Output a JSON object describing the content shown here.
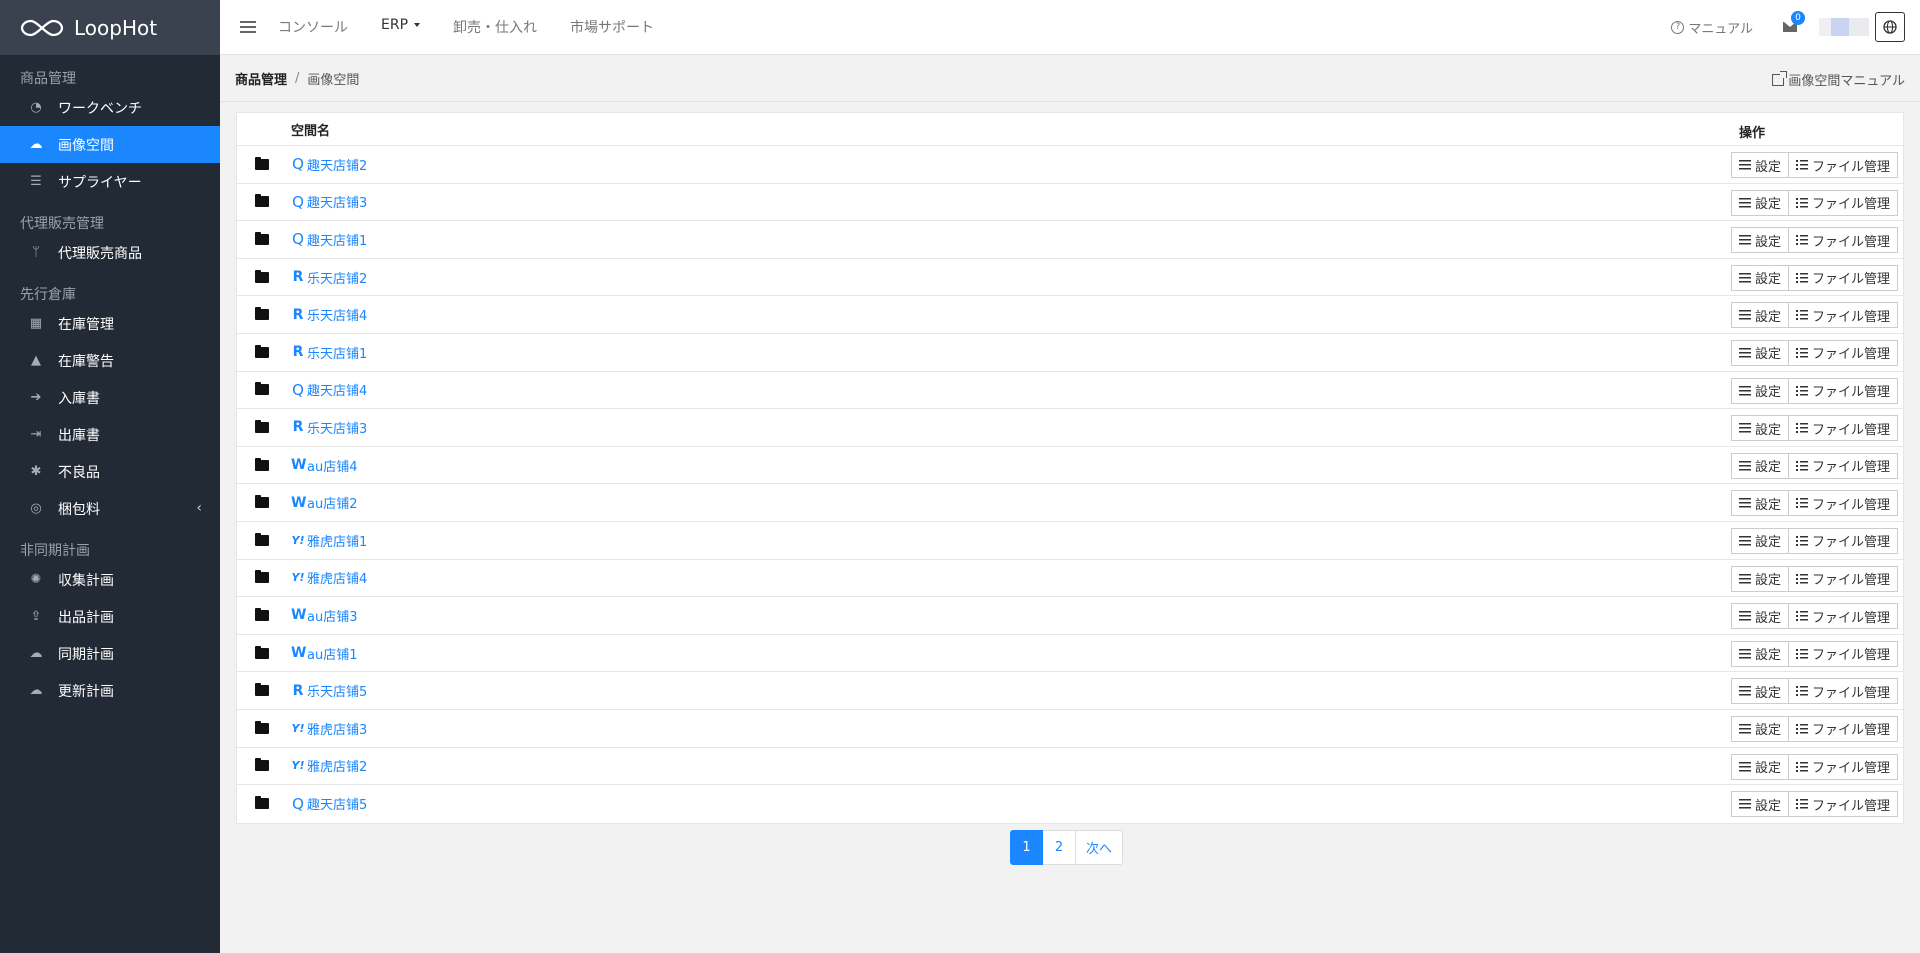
{
  "app": {
    "brand": "LoopHot"
  },
  "sidebar": {
    "sections": [
      {
        "header": "商品管理",
        "items": [
          {
            "label": "ワークベンチ",
            "icon": "dashboard-icon"
          },
          {
            "label": "画像空間",
            "icon": "cloud-icon",
            "active": true
          },
          {
            "label": "サプライヤー",
            "icon": "list-icon"
          }
        ]
      },
      {
        "header": "代理販売管理",
        "items": [
          {
            "label": "代理販売商品",
            "icon": "branch-icon"
          }
        ]
      },
      {
        "header": "先行倉庫",
        "items": [
          {
            "label": "在庫管理",
            "icon": "boxes-icon"
          },
          {
            "label": "在庫警告",
            "icon": "warning-icon"
          },
          {
            "label": "入庫書",
            "icon": "sign-in-icon"
          },
          {
            "label": "出庫書",
            "icon": "sign-out-icon"
          },
          {
            "label": "不良品",
            "icon": "bug-icon"
          },
          {
            "label": "梱包料",
            "icon": "tape-icon",
            "caret": "‹"
          }
        ]
      },
      {
        "header": "非同期計画",
        "items": [
          {
            "label": "収集計画",
            "icon": "spider-icon"
          },
          {
            "label": "出品計画",
            "icon": "upload-icon"
          },
          {
            "label": "同期計画",
            "icon": "cloud-download-icon"
          },
          {
            "label": "更新計画",
            "icon": "cloud-upload-icon"
          }
        ]
      }
    ]
  },
  "topbar": {
    "links": [
      "コンソール",
      "ERP",
      "卸売・仕入れ",
      "市場サポート"
    ],
    "manual": "マニュアル",
    "mail_count": "0"
  },
  "breadcrumb": {
    "root": "商品管理",
    "separator": "/",
    "current": "画像空間",
    "manual_link": "画像空間マニュアル"
  },
  "table": {
    "columns": {
      "name": "空間名",
      "ops": "操作"
    },
    "settings_label": "設定",
    "files_label": "ファイル管理",
    "rows": [
      {
        "mark": "Q",
        "name": "趣天店铺2"
      },
      {
        "mark": "Q",
        "name": "趣天店铺3"
      },
      {
        "mark": "Q",
        "name": "趣天店铺1"
      },
      {
        "mark": "R",
        "name": "乐天店铺2"
      },
      {
        "mark": "R",
        "name": "乐天店铺4"
      },
      {
        "mark": "R",
        "name": "乐天店铺1"
      },
      {
        "mark": "Q",
        "name": "趣天店铺4"
      },
      {
        "mark": "R",
        "name": "乐天店铺3"
      },
      {
        "mark": "W",
        "name": "au店铺4"
      },
      {
        "mark": "W",
        "name": "au店铺2"
      },
      {
        "mark": "Y!",
        "name": "雅虎店铺1"
      },
      {
        "mark": "Y!",
        "name": "雅虎店铺4"
      },
      {
        "mark": "W",
        "name": "au店铺3"
      },
      {
        "mark": "W",
        "name": "au店铺1"
      },
      {
        "mark": "R",
        "name": "乐天店铺5"
      },
      {
        "mark": "Y!",
        "name": "雅虎店铺3"
      },
      {
        "mark": "Y!",
        "name": "雅虎店铺2"
      },
      {
        "mark": "Q",
        "name": "趣天店铺5"
      }
    ]
  },
  "pagination": {
    "pages": [
      "1",
      "2"
    ],
    "current": "1",
    "next": "次へ"
  },
  "colors": {
    "accent": "#1a87ff",
    "sidebar_bg": "#222a36",
    "logo_bg": "#3a4250"
  }
}
